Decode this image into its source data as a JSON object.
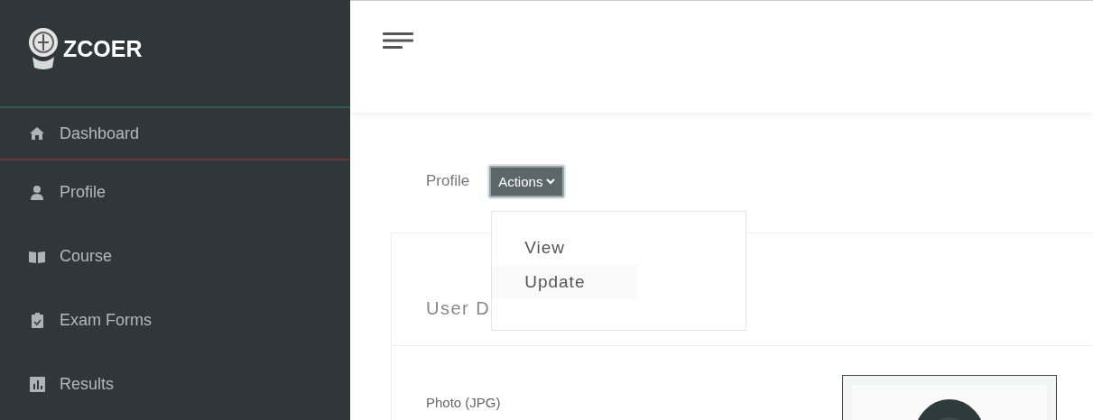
{
  "brand": {
    "name": "ZCOER"
  },
  "sidebar": {
    "items": [
      {
        "label": "Dashboard",
        "selected": true
      },
      {
        "label": "Profile",
        "selected": false
      },
      {
        "label": "Course",
        "selected": false
      },
      {
        "label": "Exam Forms",
        "selected": false
      },
      {
        "label": "Results",
        "selected": false
      }
    ]
  },
  "breadcrumb": "Profile",
  "actions": {
    "label": "Actions",
    "expanded": true,
    "menu": [
      {
        "label": "View",
        "selected": false
      },
      {
        "label": "Update",
        "selected": true
      }
    ]
  },
  "card": {
    "title": "User D",
    "fields": [
      {
        "label": "Photo (JPG)",
        "kind": "picture"
      }
    ]
  }
}
